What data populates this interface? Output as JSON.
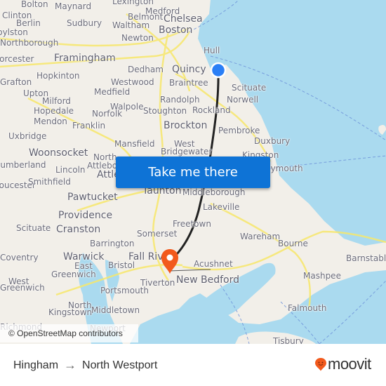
{
  "map": {
    "attribution": "© OpenStreetMap contributors",
    "colors": {
      "water": "#aadaef",
      "land": "#f2efe9",
      "road": "#f7e76b",
      "route": "#222222",
      "origin_marker": "#2a7ff6",
      "destination_marker": "#f2591c"
    },
    "places": [
      {
        "name": "Bolton",
        "size": "normal"
      },
      {
        "name": "Maynard",
        "size": "normal"
      },
      {
        "name": "Lexington",
        "size": "normal"
      },
      {
        "name": "Medford",
        "size": "normal"
      },
      {
        "name": "Clinton",
        "size": "normal"
      },
      {
        "name": "Belmont",
        "size": "normal"
      },
      {
        "name": "Chelsea",
        "size": "big"
      },
      {
        "name": "Berlin",
        "size": "normal"
      },
      {
        "name": "Sudbury",
        "size": "normal"
      },
      {
        "name": "Waltham",
        "size": "normal"
      },
      {
        "name": "Boston",
        "size": "big"
      },
      {
        "name": "Boylston",
        "size": "normal"
      },
      {
        "name": "Newton",
        "size": "normal"
      },
      {
        "name": "Northborough",
        "size": "normal"
      },
      {
        "name": "Hull",
        "size": "normal"
      },
      {
        "name": "Worcester",
        "size": "normal"
      },
      {
        "name": "Framingham",
        "size": "big"
      },
      {
        "name": "Dedham",
        "size": "normal"
      },
      {
        "name": "Quincy",
        "size": "big"
      },
      {
        "name": "Hopkinton",
        "size": "normal"
      },
      {
        "name": "Grafton",
        "size": "normal"
      },
      {
        "name": "Westwood",
        "size": "normal"
      },
      {
        "name": "Braintree",
        "size": "normal"
      },
      {
        "name": "Scituate",
        "size": "normal"
      },
      {
        "name": "Upton",
        "size": "normal"
      },
      {
        "name": "Medfield",
        "size": "normal"
      },
      {
        "name": "Norwell",
        "size": "normal"
      },
      {
        "name": "Milford",
        "size": "normal"
      },
      {
        "name": "Randolph",
        "size": "normal"
      },
      {
        "name": "Walpole",
        "size": "normal"
      },
      {
        "name": "Hopedale",
        "size": "normal"
      },
      {
        "name": "Norfolk",
        "size": "normal"
      },
      {
        "name": "Stoughton",
        "size": "normal"
      },
      {
        "name": "Rockland",
        "size": "normal"
      },
      {
        "name": "Mendon",
        "size": "normal"
      },
      {
        "name": "Franklin",
        "size": "normal"
      },
      {
        "name": "Brockton",
        "size": "big"
      },
      {
        "name": "Pembroke",
        "size": "normal"
      },
      {
        "name": "Uxbridge",
        "size": "normal"
      },
      {
        "name": "Duxbury",
        "size": "normal"
      },
      {
        "name": "Mansfield",
        "size": "normal"
      },
      {
        "name": "West",
        "size": "normal"
      },
      {
        "name": "Bridgewater",
        "size": "normal"
      },
      {
        "name": "Woonsocket",
        "size": "big"
      },
      {
        "name": "Kingston",
        "size": "normal"
      },
      {
        "name": "North",
        "size": "normal"
      },
      {
        "name": "Cumberland",
        "size": "normal"
      },
      {
        "name": "Attleboro",
        "size": "normal"
      },
      {
        "name": "Plymouth",
        "size": "normal"
      },
      {
        "name": "Lincoln",
        "size": "normal"
      },
      {
        "name": "Attleboro",
        "size": "big"
      },
      {
        "name": "Gloucester",
        "size": "normal"
      },
      {
        "name": "Smithfield",
        "size": "normal"
      },
      {
        "name": "Taunton",
        "size": "big"
      },
      {
        "name": "Middleborough",
        "size": "normal"
      },
      {
        "name": "Pawtucket",
        "size": "big"
      },
      {
        "name": "Lakeville",
        "size": "normal"
      },
      {
        "name": "Providence",
        "size": "big"
      },
      {
        "name": "Freetown",
        "size": "normal"
      },
      {
        "name": "Scituate",
        "size": "normal"
      },
      {
        "name": "Cranston",
        "size": "big"
      },
      {
        "name": "Somerset",
        "size": "normal"
      },
      {
        "name": "Wareham",
        "size": "normal"
      },
      {
        "name": "Barrington",
        "size": "normal"
      },
      {
        "name": "Bourne",
        "size": "normal"
      },
      {
        "name": "Coventry",
        "size": "normal"
      },
      {
        "name": "Warwick",
        "size": "big"
      },
      {
        "name": "Fall River",
        "size": "big"
      },
      {
        "name": "Bristol",
        "size": "normal"
      },
      {
        "name": "Acushnet",
        "size": "normal"
      },
      {
        "name": "Barnstable",
        "size": "normal"
      },
      {
        "name": "East",
        "size": "normal"
      },
      {
        "name": "Greenwich",
        "size": "normal"
      },
      {
        "name": "Mashpee",
        "size": "normal"
      },
      {
        "name": "West",
        "size": "normal"
      },
      {
        "name": "Tiverton",
        "size": "normal"
      },
      {
        "name": "New Bedford",
        "size": "big"
      },
      {
        "name": "Greenwich",
        "size": "normal"
      },
      {
        "name": "Portsmouth",
        "size": "normal"
      },
      {
        "name": "North",
        "size": "normal"
      },
      {
        "name": "Falmouth",
        "size": "normal"
      },
      {
        "name": "Kingstown",
        "size": "normal"
      },
      {
        "name": "Middletown",
        "size": "normal"
      },
      {
        "name": "Richmond",
        "size": "normal"
      },
      {
        "name": "Newport",
        "size": "normal"
      },
      {
        "name": "Tisbury",
        "size": "normal"
      }
    ]
  },
  "cta": {
    "label": "Take me there"
  },
  "footer": {
    "origin": "Hingham",
    "arrow": "→",
    "destination": "North Westport",
    "brand": "moovit"
  }
}
